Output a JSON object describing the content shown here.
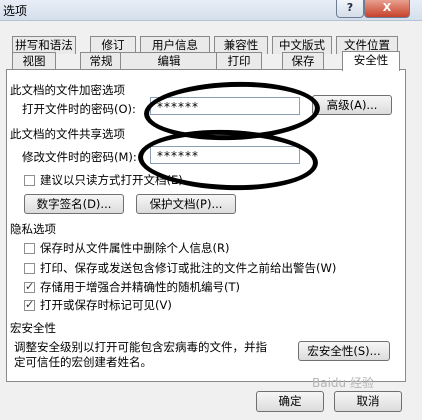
{
  "window": {
    "title": "选项",
    "help_glyph": "?",
    "close_glyph": "X"
  },
  "tabs_row1": [
    "拼写和语法",
    "修订",
    "用户信息",
    "兼容性",
    "中文版式",
    "文件位置"
  ],
  "tabs_row2": [
    "视图",
    "常规",
    "编辑",
    "打印",
    "保存",
    "安全性"
  ],
  "active_tab": "安全性",
  "encrypt": {
    "heading": "此文档的文件加密选项",
    "open_password_label": "打开文件时的密码(O):",
    "open_password_value": "******",
    "advanced_button": "高级(A)..."
  },
  "share": {
    "heading": "此文档的文件共享选项",
    "modify_password_label": "修改文件时的密码(M):",
    "modify_password_value": "******",
    "readonly_label": "建议以只读方式打开文档(E)",
    "digital_sign_button": "数字签名(D)...",
    "protect_button": "保护文档(P)..."
  },
  "privacy": {
    "heading": "隐私选项",
    "options": [
      {
        "label": "保存时从文件属性中删除个人信息(R)",
        "checked": false
      },
      {
        "label": "打印、保存或发送包含修订或批注的文件之前给出警告(W)",
        "checked": false
      },
      {
        "label": "存储用于增强合并精确性的随机编号(T)",
        "checked": true
      },
      {
        "label": "打开或保存时标记可见(V)",
        "checked": true
      }
    ]
  },
  "macro": {
    "heading": "宏安全性",
    "description_line1": "调整安全级别以打开可能包含宏病毒的文件，并指",
    "description_line2": "定可信任的宏创建者姓名。",
    "button": "宏安全性(S)..."
  },
  "footer": {
    "ok": "确定",
    "cancel": "取消"
  },
  "watermark": "Baidu 经验"
}
